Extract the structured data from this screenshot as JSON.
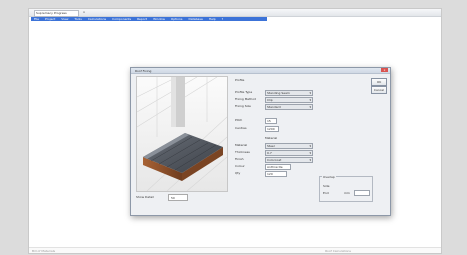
{
  "window": {
    "tab_label": "Supremacy Progress",
    "tab_close": "x"
  },
  "menu": {
    "items": [
      "File",
      "Project",
      "View",
      "Tools",
      "Calculations",
      "Components",
      "Report",
      "Window",
      "Options",
      "Database",
      "Help",
      "?"
    ]
  },
  "status": {
    "left": "Bill of Materials",
    "right": "Roof  Calculations"
  },
  "dialog": {
    "title": "Roof Fixing",
    "close": "x",
    "preview_label": "Show Detail",
    "preview_value": "50",
    "section_label": "Profile",
    "fields": [
      {
        "label": "Profile Type",
        "value": "Standing Seam"
      },
      {
        "label": "Fixing Method",
        "value": "Clip"
      },
      {
        "label": "Fixing Size",
        "value": "Standard"
      }
    ],
    "side_label": "Pitch",
    "side_value": "15",
    "centres_label": "Centres",
    "centres_value": "1200",
    "material_label": "Material",
    "rows": [
      {
        "label": "Material",
        "value": "Steel"
      },
      {
        "label": "Thickness",
        "value": "0.7"
      },
      {
        "label": "Finish",
        "value": "Colorcoat"
      },
      {
        "label": "Colour",
        "value": "Anthracite"
      },
      {
        "label": "Qty",
        "value": "120"
      }
    ],
    "group_label": "Overlap",
    "group_opt1": "Side",
    "group_opt2": "End",
    "group_val_label": "mm",
    "ok": "OK",
    "cancel": "Cancel"
  },
  "colors": {
    "menu_bg": "#3c73d8",
    "roof_dark": "#4a4f57",
    "wall_brown": "#8a4f2a"
  }
}
